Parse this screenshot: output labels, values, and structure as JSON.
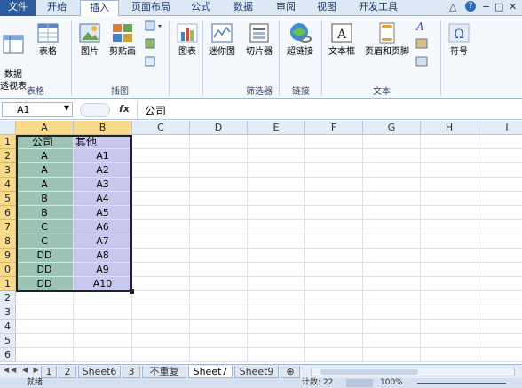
{
  "ribbon_tabs": [
    "文件",
    "开始",
    "插入",
    "页面布局",
    "公式",
    "数据",
    "审阅",
    "视图",
    "开发工具"
  ],
  "window_controls": {
    "collapse": "△",
    "help": "?",
    "minimize": "−",
    "restore": "□",
    "close": "✕"
  },
  "ribbon": {
    "buttons": {
      "pivot": "数据\n透视表",
      "table": "表格",
      "picture": "图片",
      "clipart": "剪贴画",
      "chart": "图表",
      "sparkline": "迷你图",
      "slicer": "切片器",
      "hyperlink": "超链接",
      "textbox": "文本框",
      "header_footer": "页眉和页脚",
      "symbol": "符号"
    },
    "groups": {
      "tables": "表格",
      "illustrations": "插图",
      "filter": "筛选器",
      "links": "链接",
      "text": "文本"
    }
  },
  "formula_bar": {
    "name_box": "A1",
    "fx": "fx",
    "formula": "公司"
  },
  "columns": [
    "A",
    "B",
    "C",
    "D",
    "E",
    "F",
    "G",
    "H",
    "I"
  ],
  "rows": [
    {
      "num": "1",
      "a": "公司",
      "b": "其他"
    },
    {
      "num": "2",
      "a": "A",
      "b": "A1"
    },
    {
      "num": "3",
      "a": "A",
      "b": "A2"
    },
    {
      "num": "4",
      "a": "A",
      "b": "A3"
    },
    {
      "num": "5",
      "a": "B",
      "b": "A4"
    },
    {
      "num": "6",
      "a": "B",
      "b": "A5"
    },
    {
      "num": "7",
      "a": "C",
      "b": "A6"
    },
    {
      "num": "8",
      "a": "C",
      "b": "A7"
    },
    {
      "num": "9",
      "a": "DD",
      "b": "A8"
    },
    {
      "num": "0",
      "a": "DD",
      "b": "A9"
    },
    {
      "num": "1",
      "a": "DD",
      "b": "A10"
    },
    {
      "num": "2",
      "a": "",
      "b": ""
    },
    {
      "num": "3",
      "a": "",
      "b": ""
    },
    {
      "num": "4",
      "a": "",
      "b": ""
    },
    {
      "num": "5",
      "a": "",
      "b": ""
    },
    {
      "num": "6",
      "a": "",
      "b": ""
    }
  ],
  "sheet_tabs": [
    "1",
    "2",
    "Sheet6",
    "3",
    "不重复",
    "Sheet7",
    "Sheet9"
  ],
  "active_sheet": "Sheet7",
  "status": {
    "left": "就绪",
    "count": "计数: 22",
    "zoom": "100%"
  }
}
